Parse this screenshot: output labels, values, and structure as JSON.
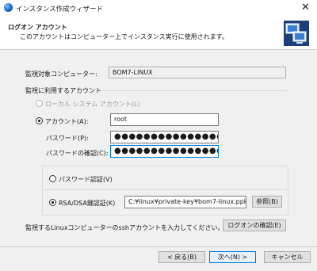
{
  "window": {
    "title": "インスタンス作成ウィザード",
    "close_glyph": "✕"
  },
  "header": {
    "title": "ログオン アカウント",
    "subtitle": "このアカウントはコンピューター上でインスタンス実行に使用されます。"
  },
  "form": {
    "target_label": "監視対象コンピューター:",
    "target_value": "BOM7-LINUX",
    "section_label": "監視に利用するアカウント",
    "local_system_label": "ローカル システム アカウント(L)",
    "account_label": "アカウント(A):",
    "account_value": "root",
    "password_label": "パスワード(P):",
    "password_value": "●●●●●●●●●●●●●●●●",
    "confirm_label": "パスワードの確認(C):",
    "confirm_value": "●●●●●●●●●●●●●●●●",
    "password_auth_label": "パスワード認証(V)",
    "rsa_auth_label": "RSA/DSA鍵認証(K)",
    "key_path_value": "C:¥linux¥private-key¥bom7-linux.ppk",
    "browse_label": "参照(B)",
    "hint_text": "監視するLinuxコンピューターのsshアカウントを入力してください。",
    "check_logon_label": "ログオンの確認(E)",
    "selected_account_mode": "account",
    "selected_auth_mode": "rsa"
  },
  "footer": {
    "back_label": "< 戻る(B)",
    "next_label": "次へ(N) >",
    "cancel_label": "キャンセル"
  },
  "colors": {
    "focus_border": "#0078d7",
    "dialog_bg": "#f0f0f0",
    "app_icon": "#1466c8"
  },
  "icons": {
    "app": "globe-icon",
    "header": "computers-network-icon",
    "close": "close-icon"
  }
}
